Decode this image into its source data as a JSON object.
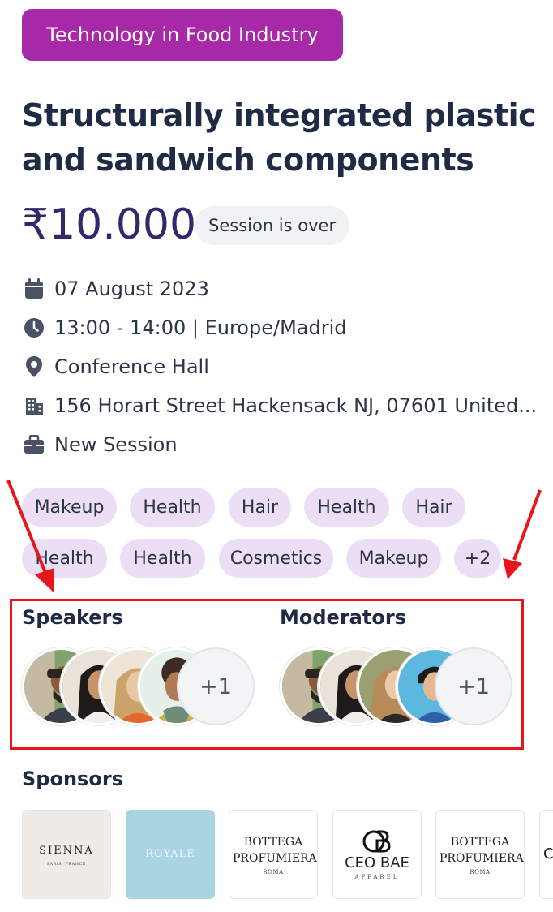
{
  "category": "Technology in Food Industry",
  "title": "Structurally integrated plastic and sandwich components",
  "price": "₹10.000",
  "status": "Session is over",
  "info": {
    "date": "07 August 2023",
    "time": "13:00 - 14:00 | Europe/Madrid",
    "venue": "Conference Hall",
    "address": "156 Horart Street Hackensack NJ, 07601 United...",
    "type": "New Session"
  },
  "tags": [
    "Makeup",
    "Health",
    "Hair",
    "Health",
    "Hair",
    "Health",
    "Health",
    "Cosmetics",
    "Makeup",
    "+2"
  ],
  "speakers": {
    "title": "Speakers",
    "more": "+1"
  },
  "moderators": {
    "title": "Moderators",
    "more": "+1"
  },
  "sponsors": {
    "title": "Sponsors",
    "items": [
      {
        "name": "SIENNA",
        "sub": "PARIS, FRANCE"
      },
      {
        "name": "ROYALE",
        "sub": ""
      },
      {
        "name": "BOTTEGA PROFUMIERA",
        "sub": "ROMA"
      },
      {
        "name": "CEO BAE",
        "sub": "APPAREL"
      },
      {
        "name": "BOTTEGA PROFUMIERA",
        "sub": "ROMA"
      },
      {
        "name": "C",
        "sub": ""
      }
    ]
  },
  "colors": {
    "category_pill": "#a829a8",
    "tag_bg": "#ecdff5",
    "price": "#2e2a6b",
    "highlight": "#e8161b"
  },
  "icons": [
    "calendar-icon",
    "clock-icon",
    "map-pin-icon",
    "building-icon",
    "briefcase-icon"
  ]
}
